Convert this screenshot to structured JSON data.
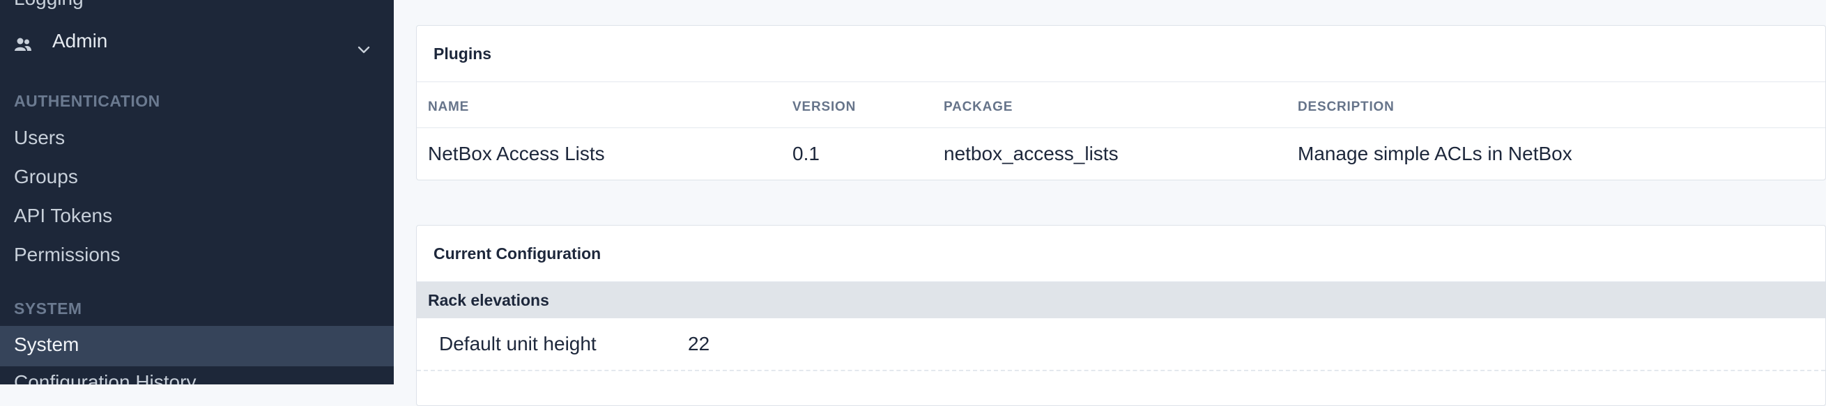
{
  "sidebar": {
    "partial_item": "Logging",
    "admin": {
      "label": "Admin",
      "icon": "users-icon",
      "chevron": "chevron-down-icon"
    },
    "sections": [
      {
        "heading": "AUTHENTICATION",
        "items": [
          "Users",
          "Groups",
          "API Tokens",
          "Permissions"
        ]
      },
      {
        "heading": "SYSTEM",
        "active_item": "System",
        "partial_item": "Configuration History"
      }
    ]
  },
  "plugins": {
    "title": "Plugins",
    "columns": [
      "NAME",
      "VERSION",
      "PACKAGE",
      "DESCRIPTION"
    ],
    "rows": [
      {
        "name": "NetBox Access Lists",
        "version": "0.1",
        "package": "netbox_access_lists",
        "description": "Manage simple ACLs in NetBox"
      }
    ]
  },
  "config": {
    "title": "Current Configuration",
    "group": "Rack elevations",
    "rows": [
      {
        "key": "Default unit height",
        "value": "22"
      }
    ]
  },
  "colors": {
    "sidebar_bg": "#1d2739",
    "sidebar_active_bg": "#36445a",
    "page_bg": "#f6f8fb",
    "group_row_bg": "#e0e4e9"
  }
}
